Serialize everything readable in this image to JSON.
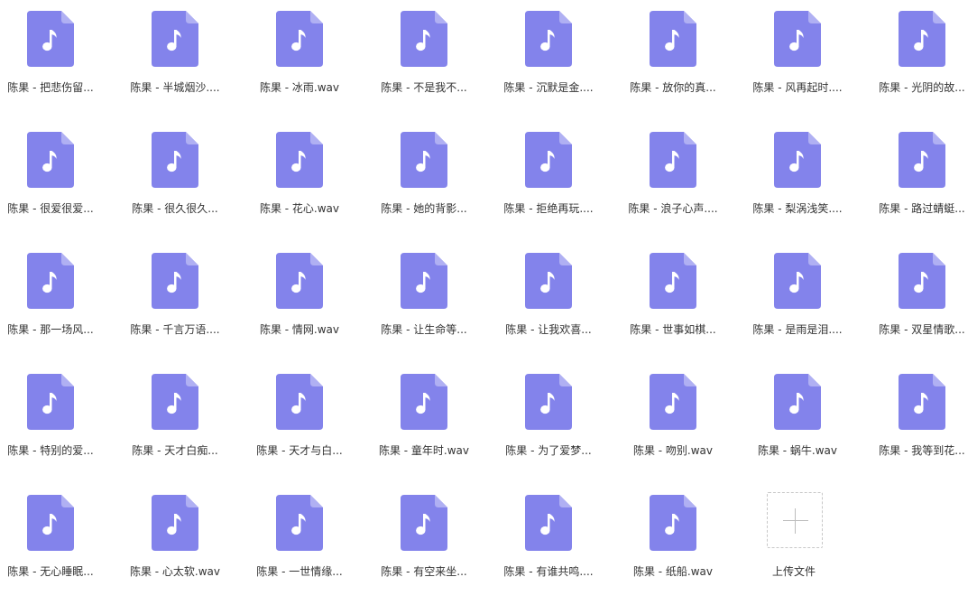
{
  "colors": {
    "file_icon": "#8383eb",
    "file_icon_fold": "#b0b0f3",
    "note": "#ffffff",
    "label_text": "#333333",
    "upload_border": "#c8c8c8"
  },
  "icons": {
    "file": "music-file-icon",
    "upload": "plus-icon"
  },
  "files": [
    "陈果 - 把悲伤留...",
    "陈果 - 半城烟沙....",
    "陈果 - 冰雨.wav",
    "陈果 - 不是我不...",
    "陈果 - 沉默是金....",
    "陈果 - 放你的真...",
    "陈果 - 风再起时....",
    "陈果 - 光阴的故...",
    "陈果 - 很爱很爱...",
    "陈果 - 很久很久...",
    "陈果 - 花心.wav",
    "陈果 - 她的背影...",
    "陈果 - 拒绝再玩....",
    "陈果 - 浪子心声....",
    "陈果 - 梨涡浅笑....",
    "陈果 - 路过蜻蜓...",
    "陈果 - 那一场风...",
    "陈果 - 千言万语....",
    "陈果 - 情网.wav",
    "陈果 - 让生命等...",
    "陈果 - 让我欢喜...",
    "陈果 - 世事如棋...",
    "陈果 - 是雨是泪....",
    "陈果 - 双星情歌...",
    "陈果 - 特别的爱...",
    "陈果 - 天才白痴...",
    "陈果 - 天才与白...",
    "陈果 - 童年时.wav",
    "陈果 - 为了爱梦...",
    "陈果 - 吻别.wav",
    "陈果 - 蜗牛.wav",
    "陈果 - 我等到花...",
    "陈果 - 无心睡眠...",
    "陈果 - 心太软.wav",
    "陈果 - 一世情缘...",
    "陈果 - 有空来坐...",
    "陈果 - 有谁共鸣....",
    "陈果 - 纸船.wav"
  ],
  "upload": {
    "label": "上传文件"
  }
}
